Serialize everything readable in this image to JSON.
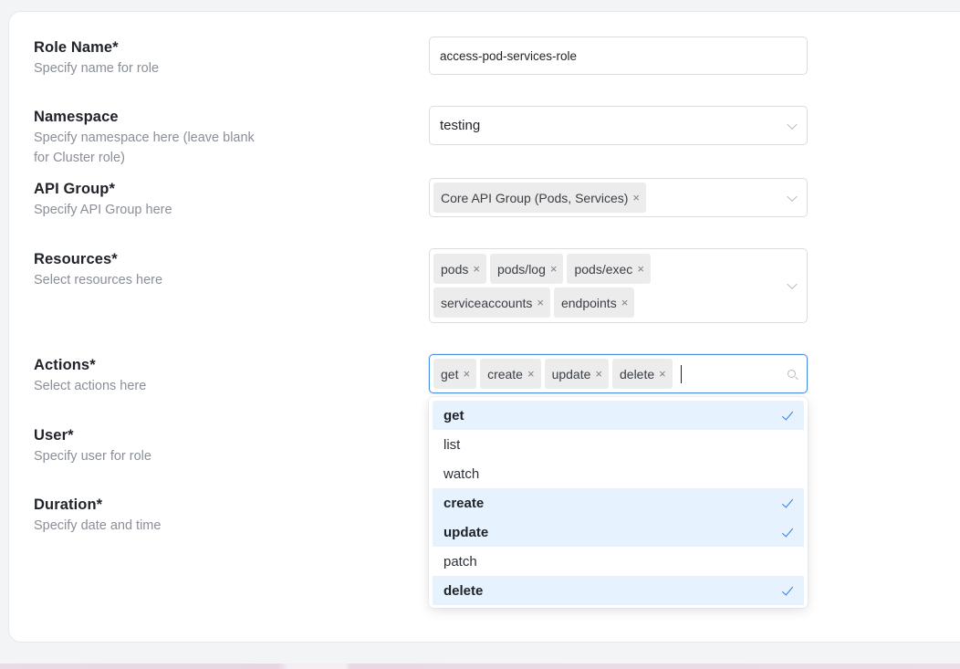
{
  "form": {
    "role_name": {
      "title": "Role Name*",
      "hint": "Specify name for role",
      "value": "access-pod-services-role"
    },
    "namespace": {
      "title": "Namespace",
      "hint_line1": "Specify namespace here (leave blank",
      "hint_line2": "for Cluster role)",
      "value": "testing"
    },
    "api_group": {
      "title": "API Group*",
      "hint": "Specify API Group here",
      "tags": [
        "Core API Group (Pods, Services)"
      ]
    },
    "resources": {
      "title": "Resources*",
      "hint": "Select resources here",
      "tags": [
        "pods",
        "pods/log",
        "pods/exec",
        "serviceaccounts",
        "endpoints"
      ]
    },
    "actions": {
      "title": "Actions*",
      "hint": "Select actions here",
      "tags": [
        "get",
        "create",
        "update",
        "delete"
      ]
    },
    "user": {
      "title": "User*",
      "hint": "Specify user for role"
    },
    "duration": {
      "title": "Duration*",
      "hint": "Specify date and time"
    }
  },
  "dropdown": {
    "options": [
      {
        "label": "get",
        "selected": true
      },
      {
        "label": "list",
        "selected": false
      },
      {
        "label": "watch",
        "selected": false
      },
      {
        "label": "create",
        "selected": true
      },
      {
        "label": "update",
        "selected": true
      },
      {
        "label": "patch",
        "selected": false
      },
      {
        "label": "delete",
        "selected": true
      }
    ]
  },
  "tag_remove_symbol": "×",
  "colors": {
    "accent": "#2f7de0",
    "selected_bg": "#e6f2fd",
    "tag_bg": "#ececec"
  }
}
